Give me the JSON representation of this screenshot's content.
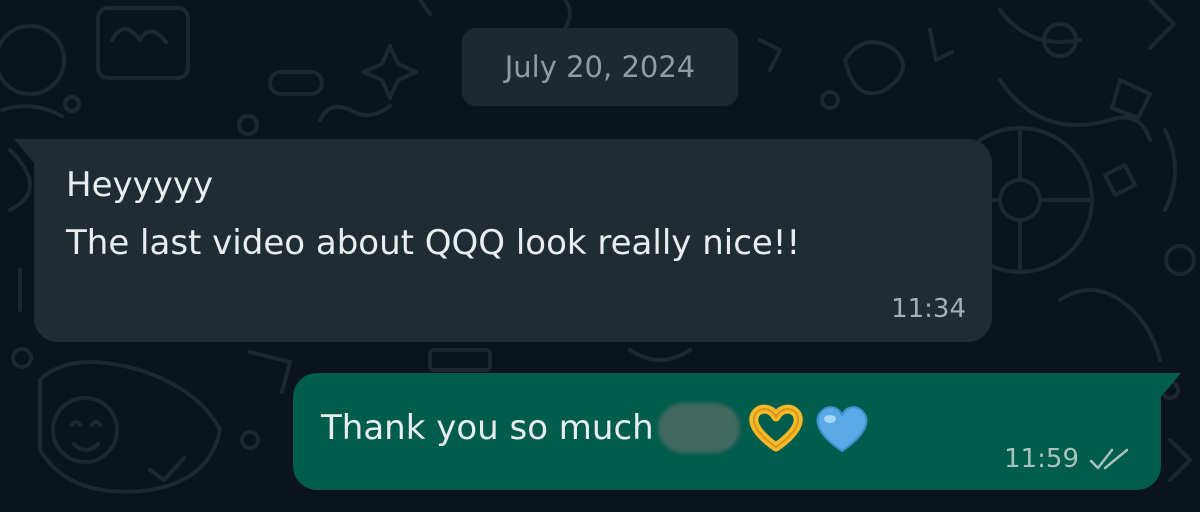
{
  "date_separator": "July 20, 2024",
  "messages": [
    {
      "direction": "incoming",
      "lines": [
        "Heyyyyy",
        "The last video about QQQ look really nice!!"
      ],
      "time": "11:34"
    },
    {
      "direction": "outgoing",
      "text": "Thank you so much",
      "redacted": true,
      "emojis": [
        "heart-hands-emoji",
        "blue-heart-emoji"
      ],
      "time": "11:59",
      "status": "double-check-read"
    }
  ],
  "colors": {
    "background": "#0b141a",
    "incoming_bubble": "#202c33",
    "outgoing_bubble": "#005c4b",
    "text": "#e9edef"
  }
}
